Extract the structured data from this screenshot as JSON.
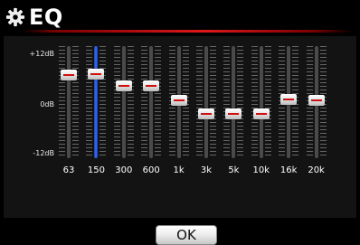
{
  "header": {
    "title": "EQ",
    "icon": "gear-icon",
    "accent_color": "#e01818"
  },
  "scale": {
    "max_label": "+12dB",
    "mid_label": "0dB",
    "min_label": "-12dB",
    "max_db": 12,
    "min_db": -12
  },
  "bands": [
    {
      "label": "63",
      "gain_db": 5.8,
      "selected": false
    },
    {
      "label": "150",
      "gain_db": 6.0,
      "selected": true
    },
    {
      "label": "300",
      "gain_db": 3.5,
      "selected": false
    },
    {
      "label": "600",
      "gain_db": 3.5,
      "selected": false
    },
    {
      "label": "1k",
      "gain_db": 0.3,
      "selected": false
    },
    {
      "label": "3k",
      "gain_db": -2.5,
      "selected": false
    },
    {
      "label": "5k",
      "gain_db": -2.5,
      "selected": false
    },
    {
      "label": "10k",
      "gain_db": -2.5,
      "selected": false
    },
    {
      "label": "16k",
      "gain_db": 0.5,
      "selected": false
    },
    {
      "label": "20k",
      "gain_db": 0.3,
      "selected": false
    }
  ],
  "ok_label": "OK",
  "selected_color": "#3c6cf0"
}
